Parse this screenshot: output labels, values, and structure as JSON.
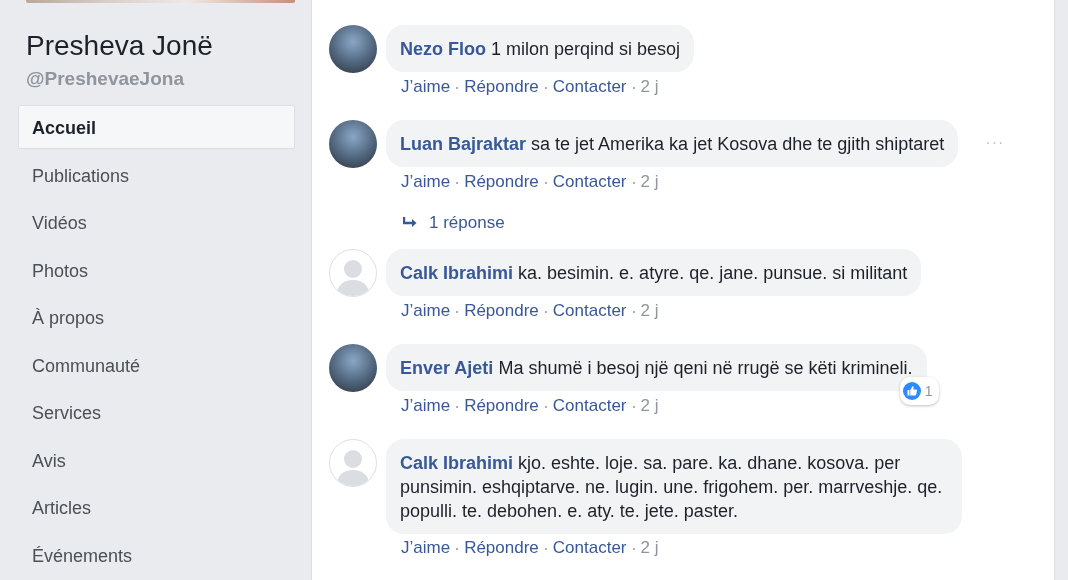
{
  "sidebar": {
    "page_name": "Presheva Jonë",
    "handle": "@PreshevaeJona",
    "items": [
      {
        "label": "Accueil",
        "selected": true
      },
      {
        "label": "Publications",
        "selected": false
      },
      {
        "label": "Vidéos",
        "selected": false
      },
      {
        "label": "Photos",
        "selected": false
      },
      {
        "label": "À propos",
        "selected": false
      },
      {
        "label": "Communauté",
        "selected": false
      },
      {
        "label": "Services",
        "selected": false
      },
      {
        "label": "Avis",
        "selected": false
      },
      {
        "label": "Articles",
        "selected": false
      },
      {
        "label": "Événements",
        "selected": false
      }
    ]
  },
  "comments": [
    {
      "author": "Nezo Floo",
      "kind": "photo",
      "text": "1 milon perqind si besoj",
      "actions": [
        "J’aime",
        "Répondre",
        "Contacter"
      ],
      "time": "2 j"
    },
    {
      "author": "Luan Bajraktar",
      "kind": "photo",
      "text": "sa te jet Amerika ka jet Kosova dhe te gjith shiptaret",
      "actions": [
        "J’aime",
        "Répondre",
        "Contacter"
      ],
      "time": "2 j",
      "menu": "···",
      "replies": "1 réponse"
    },
    {
      "author": "Calk Ibrahimi",
      "kind": "default",
      "text": "ka. besimin. e. atyre. qe. jane. punsue. si militant",
      "actions": [
        "J’aime",
        "Répondre",
        "Contacter"
      ],
      "time": "2 j"
    },
    {
      "author": "Enver Ajeti",
      "kind": "photo",
      "text": "Ma shumë i besoj një qeni në rrugë se këti krimineli.",
      "actions": [
        "J’aime",
        "Répondre",
        "Contacter"
      ],
      "time": "2 j",
      "likes": "1"
    },
    {
      "author": "Calk Ibrahimi",
      "kind": "default",
      "text": "kjo. eshte. loje. sa. pare. ka. dhane. kosova. per punsimin. eshqiptarve. ne. lugin. une. frigohem. per. marrveshje. qe. populli. te. debohen. e. aty. te. jete. paster.",
      "actions": [
        "J’aime",
        "Répondre",
        "Contacter"
      ],
      "time": "2 j"
    }
  ]
}
